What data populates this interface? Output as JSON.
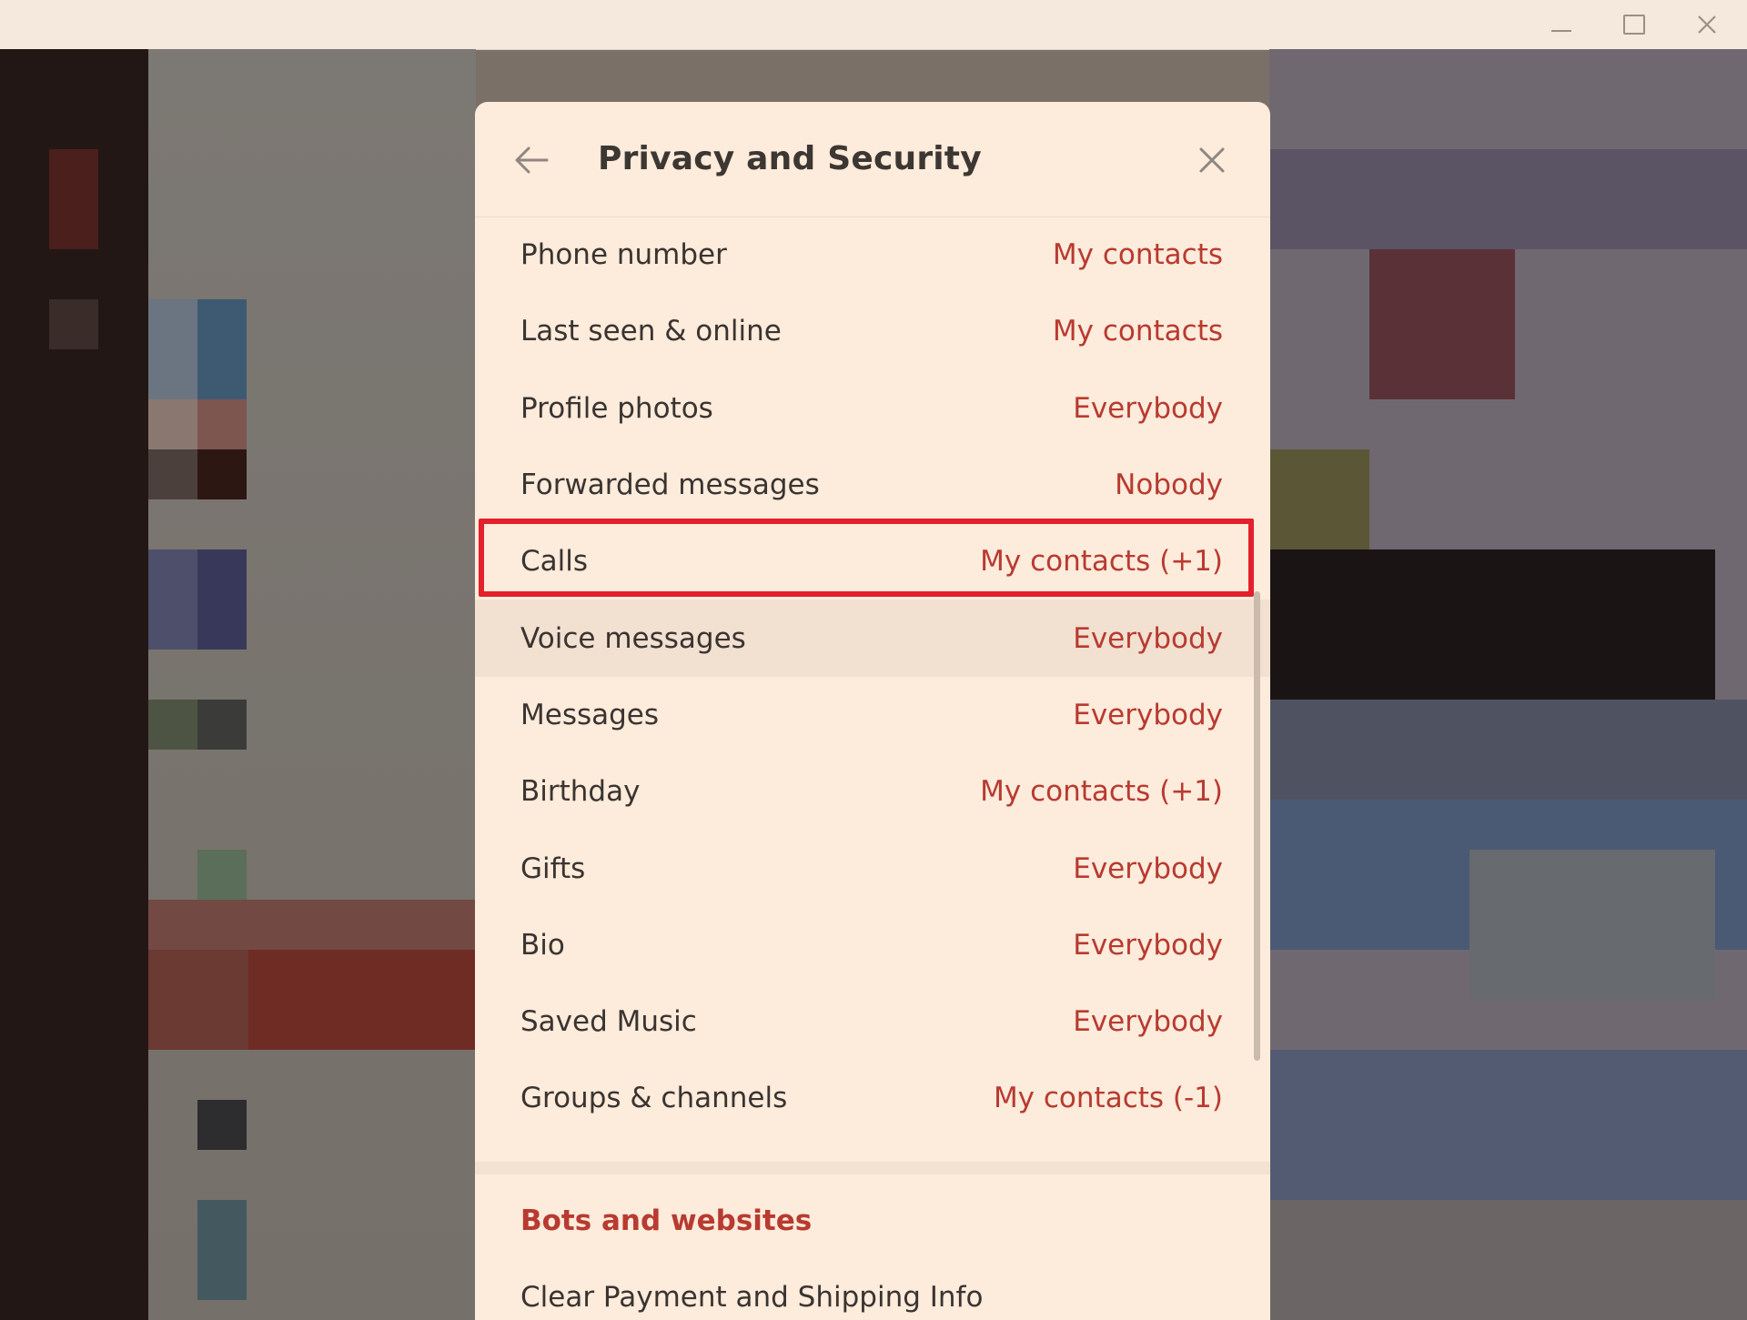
{
  "window": {
    "controls": {
      "minimize": "minimize-icon",
      "maximize": "maximize-icon",
      "close": "close-icon"
    }
  },
  "dialog": {
    "title": "Privacy and Security",
    "back_icon": "back-arrow-icon",
    "close_icon": "close-icon",
    "rows": [
      {
        "label": "Phone number",
        "value": "My contacts"
      },
      {
        "label": "Last seen & online",
        "value": "My contacts"
      },
      {
        "label": "Profile photos",
        "value": "Everybody"
      },
      {
        "label": "Forwarded messages",
        "value": "Nobody"
      },
      {
        "label": "Calls",
        "value": "My contacts (+1)"
      },
      {
        "label": "Voice messages",
        "value": "Everybody"
      },
      {
        "label": "Messages",
        "value": "Everybody"
      },
      {
        "label": "Birthday",
        "value": "My contacts (+1)"
      },
      {
        "label": "Gifts",
        "value": "Everybody"
      },
      {
        "label": "Bio",
        "value": "Everybody"
      },
      {
        "label": "Saved Music",
        "value": "Everybody"
      },
      {
        "label": "Groups & channels",
        "value": "My contacts (-1)"
      }
    ],
    "section": {
      "title": "Bots and websites",
      "items": [
        "Clear Payment and Shipping Info"
      ]
    }
  },
  "colors": {
    "dialog_bg": "#fdebdb",
    "accent": "#b83a30",
    "highlight": "#e3202c"
  }
}
